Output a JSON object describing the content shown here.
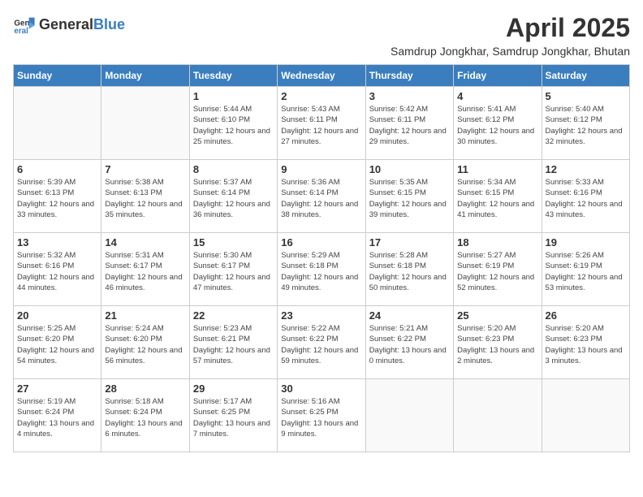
{
  "logo": {
    "general": "General",
    "blue": "Blue"
  },
  "title": "April 2025",
  "subtitle": "Samdrup Jongkhar, Samdrup Jongkhar, Bhutan",
  "days_of_week": [
    "Sunday",
    "Monday",
    "Tuesday",
    "Wednesday",
    "Thursday",
    "Friday",
    "Saturday"
  ],
  "weeks": [
    [
      {
        "day": "",
        "info": ""
      },
      {
        "day": "",
        "info": ""
      },
      {
        "day": "1",
        "info": "Sunrise: 5:44 AM\nSunset: 6:10 PM\nDaylight: 12 hours and 25 minutes."
      },
      {
        "day": "2",
        "info": "Sunrise: 5:43 AM\nSunset: 6:11 PM\nDaylight: 12 hours and 27 minutes."
      },
      {
        "day": "3",
        "info": "Sunrise: 5:42 AM\nSunset: 6:11 PM\nDaylight: 12 hours and 29 minutes."
      },
      {
        "day": "4",
        "info": "Sunrise: 5:41 AM\nSunset: 6:12 PM\nDaylight: 12 hours and 30 minutes."
      },
      {
        "day": "5",
        "info": "Sunrise: 5:40 AM\nSunset: 6:12 PM\nDaylight: 12 hours and 32 minutes."
      }
    ],
    [
      {
        "day": "6",
        "info": "Sunrise: 5:39 AM\nSunset: 6:13 PM\nDaylight: 12 hours and 33 minutes."
      },
      {
        "day": "7",
        "info": "Sunrise: 5:38 AM\nSunset: 6:13 PM\nDaylight: 12 hours and 35 minutes."
      },
      {
        "day": "8",
        "info": "Sunrise: 5:37 AM\nSunset: 6:14 PM\nDaylight: 12 hours and 36 minutes."
      },
      {
        "day": "9",
        "info": "Sunrise: 5:36 AM\nSunset: 6:14 PM\nDaylight: 12 hours and 38 minutes."
      },
      {
        "day": "10",
        "info": "Sunrise: 5:35 AM\nSunset: 6:15 PM\nDaylight: 12 hours and 39 minutes."
      },
      {
        "day": "11",
        "info": "Sunrise: 5:34 AM\nSunset: 6:15 PM\nDaylight: 12 hours and 41 minutes."
      },
      {
        "day": "12",
        "info": "Sunrise: 5:33 AM\nSunset: 6:16 PM\nDaylight: 12 hours and 43 minutes."
      }
    ],
    [
      {
        "day": "13",
        "info": "Sunrise: 5:32 AM\nSunset: 6:16 PM\nDaylight: 12 hours and 44 minutes."
      },
      {
        "day": "14",
        "info": "Sunrise: 5:31 AM\nSunset: 6:17 PM\nDaylight: 12 hours and 46 minutes."
      },
      {
        "day": "15",
        "info": "Sunrise: 5:30 AM\nSunset: 6:17 PM\nDaylight: 12 hours and 47 minutes."
      },
      {
        "day": "16",
        "info": "Sunrise: 5:29 AM\nSunset: 6:18 PM\nDaylight: 12 hours and 49 minutes."
      },
      {
        "day": "17",
        "info": "Sunrise: 5:28 AM\nSunset: 6:18 PM\nDaylight: 12 hours and 50 minutes."
      },
      {
        "day": "18",
        "info": "Sunrise: 5:27 AM\nSunset: 6:19 PM\nDaylight: 12 hours and 52 minutes."
      },
      {
        "day": "19",
        "info": "Sunrise: 5:26 AM\nSunset: 6:19 PM\nDaylight: 12 hours and 53 minutes."
      }
    ],
    [
      {
        "day": "20",
        "info": "Sunrise: 5:25 AM\nSunset: 6:20 PM\nDaylight: 12 hours and 54 minutes."
      },
      {
        "day": "21",
        "info": "Sunrise: 5:24 AM\nSunset: 6:20 PM\nDaylight: 12 hours and 56 minutes."
      },
      {
        "day": "22",
        "info": "Sunrise: 5:23 AM\nSunset: 6:21 PM\nDaylight: 12 hours and 57 minutes."
      },
      {
        "day": "23",
        "info": "Sunrise: 5:22 AM\nSunset: 6:22 PM\nDaylight: 12 hours and 59 minutes."
      },
      {
        "day": "24",
        "info": "Sunrise: 5:21 AM\nSunset: 6:22 PM\nDaylight: 13 hours and 0 minutes."
      },
      {
        "day": "25",
        "info": "Sunrise: 5:20 AM\nSunset: 6:23 PM\nDaylight: 13 hours and 2 minutes."
      },
      {
        "day": "26",
        "info": "Sunrise: 5:20 AM\nSunset: 6:23 PM\nDaylight: 13 hours and 3 minutes."
      }
    ],
    [
      {
        "day": "27",
        "info": "Sunrise: 5:19 AM\nSunset: 6:24 PM\nDaylight: 13 hours and 4 minutes."
      },
      {
        "day": "28",
        "info": "Sunrise: 5:18 AM\nSunset: 6:24 PM\nDaylight: 13 hours and 6 minutes."
      },
      {
        "day": "29",
        "info": "Sunrise: 5:17 AM\nSunset: 6:25 PM\nDaylight: 13 hours and 7 minutes."
      },
      {
        "day": "30",
        "info": "Sunrise: 5:16 AM\nSunset: 6:25 PM\nDaylight: 13 hours and 9 minutes."
      },
      {
        "day": "",
        "info": ""
      },
      {
        "day": "",
        "info": ""
      },
      {
        "day": "",
        "info": ""
      }
    ]
  ]
}
